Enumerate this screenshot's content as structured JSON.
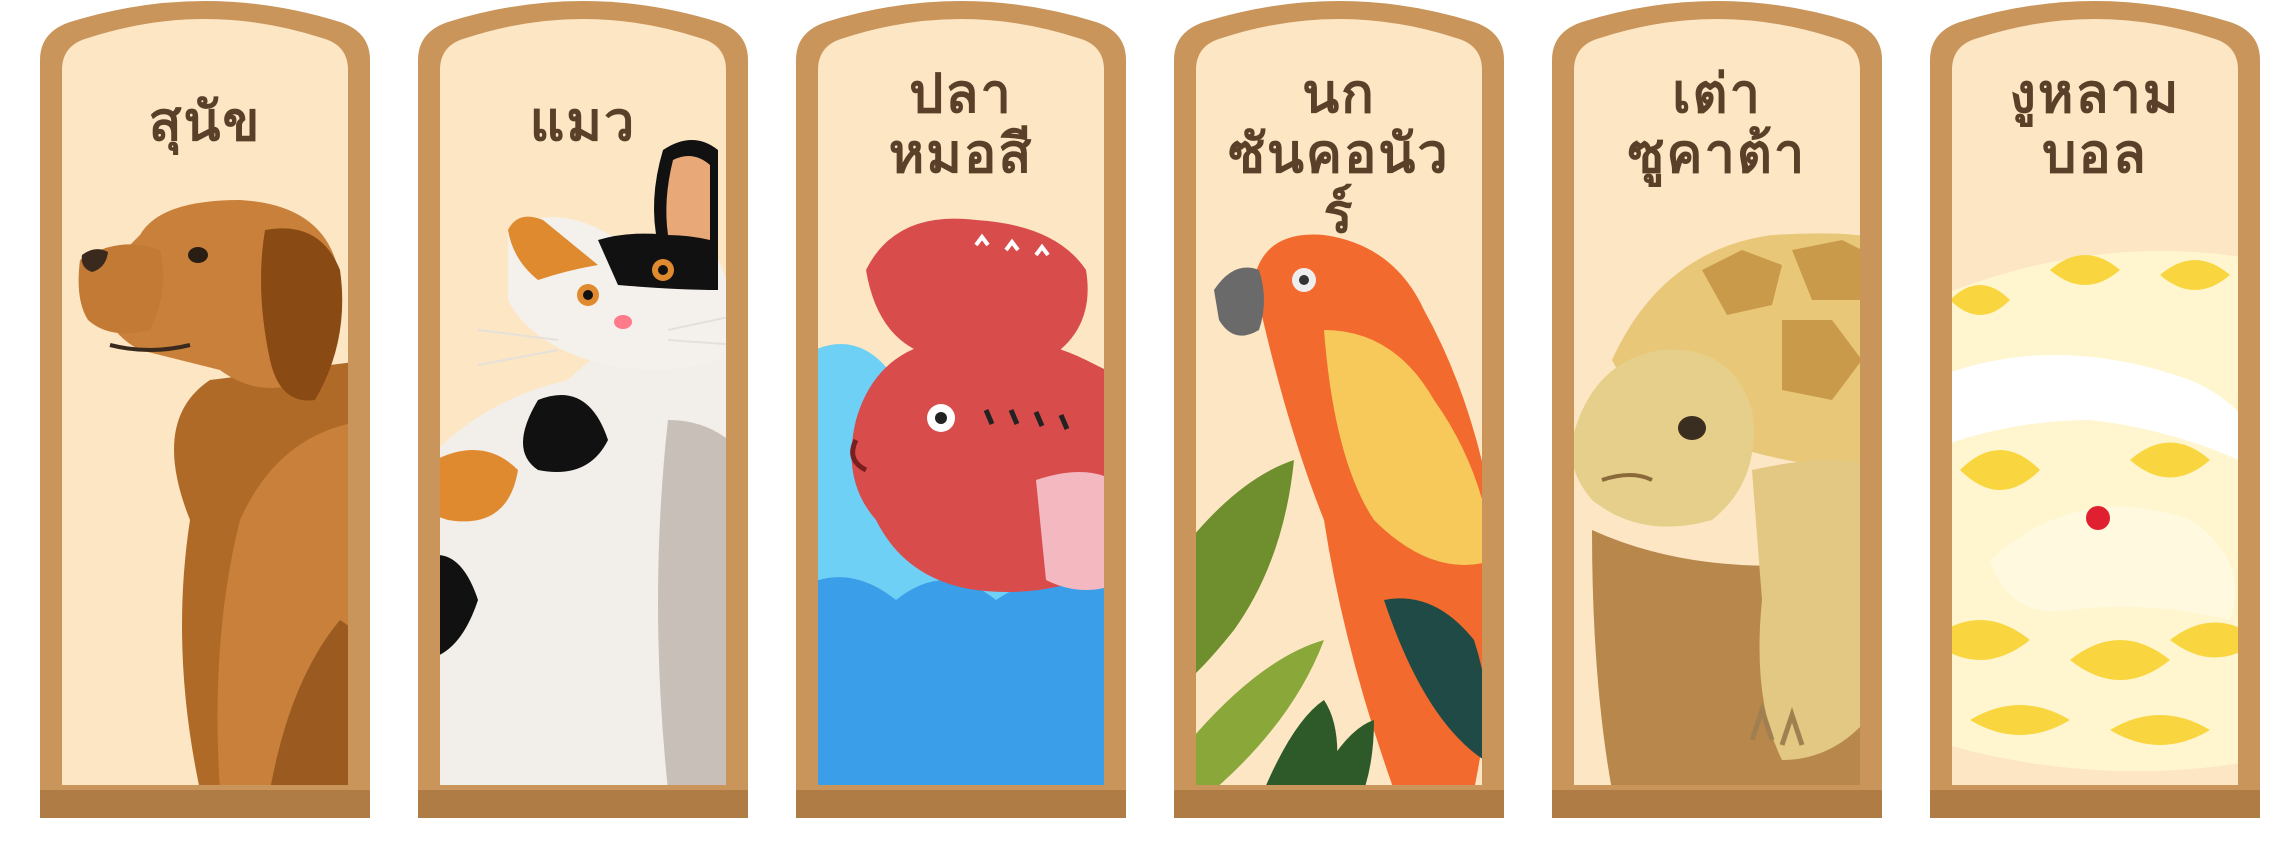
{
  "colors": {
    "frame": "#c9955b",
    "frame_dark": "#b07c45",
    "panel": "#fde6c4",
    "title_text": "#5a4028"
  },
  "cards": [
    {
      "lines": [
        "สุนัข"
      ],
      "animal_icon": "dog-illustration"
    },
    {
      "lines": [
        "แมว"
      ],
      "animal_icon": "calico-cat-illustration"
    },
    {
      "lines": [
        "ปลา",
        "หมอสี"
      ],
      "animal_icon": "flowerhorn-fish-illustration"
    },
    {
      "lines": [
        "นก",
        "ซันคอนัวร์"
      ],
      "animal_icon": "sun-conure-parrot-illustration"
    },
    {
      "lines": [
        "เต่า",
        "ซูคาต้า"
      ],
      "animal_icon": "sulcata-tortoise-illustration"
    },
    {
      "lines": [
        "งูหลาม",
        "บอล"
      ],
      "animal_icon": "ball-python-illustration"
    }
  ]
}
